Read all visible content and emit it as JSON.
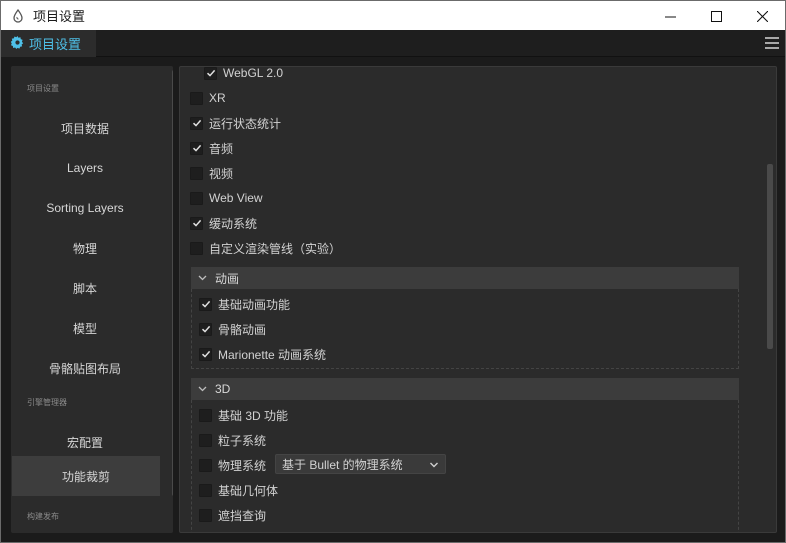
{
  "window": {
    "title": "项目设置"
  },
  "tab": {
    "label": "项目设置",
    "icon": "gear-icon"
  },
  "sidebar": {
    "groups": {
      "project": "项目设置",
      "engine": "引擎管理器",
      "build": "构建发布"
    },
    "items": [
      {
        "label": "项目数据"
      },
      {
        "label": "Layers"
      },
      {
        "label": "Sorting Layers"
      },
      {
        "label": "物理"
      },
      {
        "label": "脚本"
      },
      {
        "label": "模型"
      },
      {
        "label": "骨骼贴图布局"
      },
      {
        "label": "宏配置"
      },
      {
        "label": "功能裁剪",
        "active": true
      }
    ]
  },
  "features": {
    "top": [
      {
        "label": "WebGL 2.0",
        "checked": true
      },
      {
        "label": "XR",
        "checked": false
      },
      {
        "label": "运行状态统计",
        "checked": true
      },
      {
        "label": "音频",
        "checked": true
      },
      {
        "label": "视频",
        "checked": false
      },
      {
        "label": "Web View",
        "checked": false
      },
      {
        "label": "缓动系统",
        "checked": true
      },
      {
        "label": "自定义渲染管线（实验）",
        "checked": false
      }
    ],
    "animation": {
      "title": "动画",
      "items": [
        {
          "label": "基础动画功能",
          "checked": true
        },
        {
          "label": "骨骼动画",
          "checked": true
        },
        {
          "label": "Marionette 动画系统",
          "checked": true
        }
      ]
    },
    "three_d": {
      "title": "3D",
      "items": [
        {
          "label": "基础 3D 功能",
          "checked": false
        },
        {
          "label": "粒子系统",
          "checked": false
        },
        {
          "label": "物理系统",
          "checked": false
        },
        {
          "label": "基础几何体",
          "checked": false
        },
        {
          "label": "遮挡查询",
          "checked": false
        }
      ],
      "physics_select": "基于 Bullet 的物理系统"
    }
  },
  "colors": {
    "accent": "#4fc1e9",
    "panel": "#2b2b2b",
    "background": "#1b1b1b"
  }
}
